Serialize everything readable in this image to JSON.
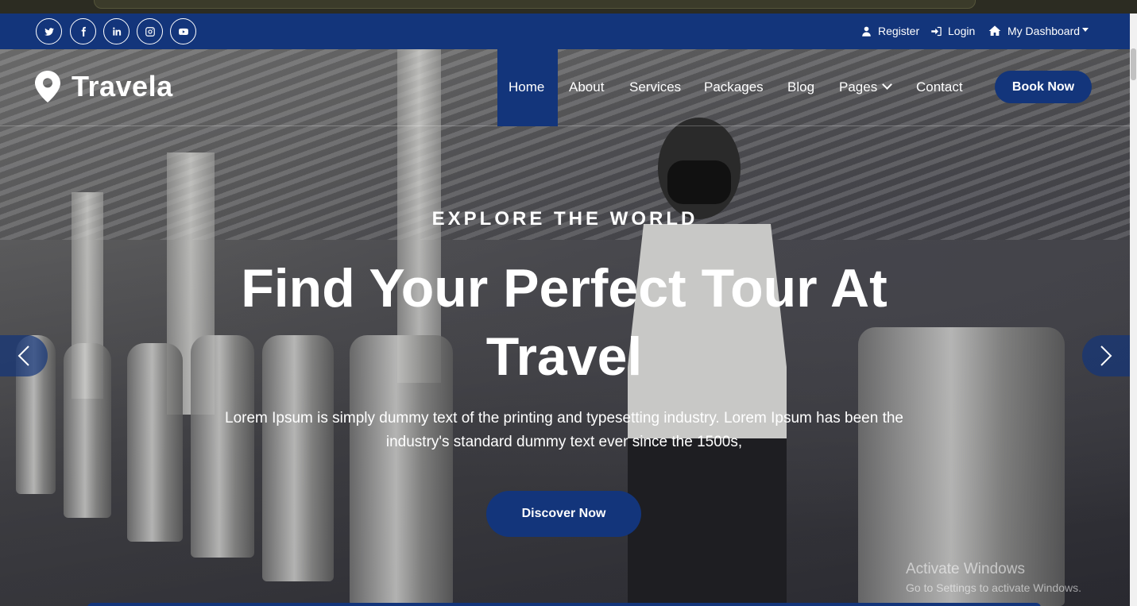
{
  "social": [
    "twitter-icon",
    "facebook-icon",
    "linkedin-icon",
    "instagram-icon",
    "youtube-icon"
  ],
  "topbar": {
    "register": "Register",
    "login": "Login",
    "dashboard": "My Dashboard"
  },
  "brand": {
    "name": "Travela",
    "icon": "map-pin-icon"
  },
  "nav": {
    "items": [
      "Home",
      "About",
      "Services",
      "Packages",
      "Blog",
      "Pages",
      "Contact"
    ],
    "active": "Home",
    "book_now": "Book Now"
  },
  "hero": {
    "eyebrow": "EXPLORE THE WORLD",
    "title": "Find Your Perfect Tour At Travel",
    "text": "Lorem Ipsum is simply dummy text of the printing and typesetting industry. Lorem Ipsum has been the industry's standard dummy text ever since the 1500s,",
    "cta": "Discover Now"
  },
  "watermark": {
    "line1": "Activate Windows",
    "line2": "Go to Settings to activate Windows."
  },
  "colors": {
    "brand": "#13357b",
    "text": "#ffffff"
  }
}
